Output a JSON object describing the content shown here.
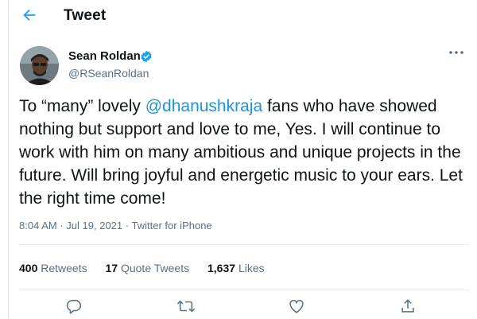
{
  "header": {
    "title": "Tweet"
  },
  "user": {
    "name": "Sean Roldan",
    "handle": "@RSeanRoldan"
  },
  "tweet": {
    "before_mention": "To “many” lovely ",
    "mention": "@dhanushkraja",
    "after_mention": " fans who have showed nothing but support and love to me, Yes. I will continue to work with him on many ambitious and unique projects in the future. Will bring joyful and energetic music to your ears. Let the right time come!"
  },
  "meta": {
    "time": "8:04 AM",
    "separator": "·",
    "date": "Jul 19, 2021",
    "source": "Twitter for iPhone"
  },
  "stats": {
    "retweets_count": "400",
    "retweets_label": "Retweets",
    "quotes_count": "17",
    "quotes_label": "Quote Tweets",
    "likes_count": "1,637",
    "likes_label": "Likes"
  },
  "icons": {
    "back": "arrow-left-icon",
    "verified": "verified-badge-icon",
    "more": "more-dots-icon",
    "reply": "reply-icon",
    "retweet": "retweet-icon",
    "like": "heart-icon",
    "share": "share-icon"
  },
  "colors": {
    "accent": "#1da1f2",
    "mention": "#1b95e0",
    "muted": "#5b7083",
    "border": "#e6ecf0"
  }
}
